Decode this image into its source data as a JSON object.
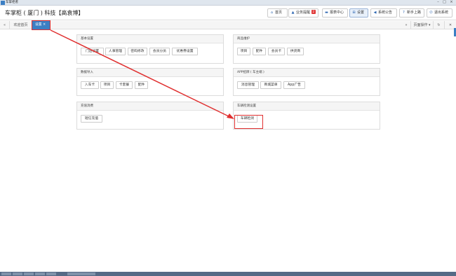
{
  "window": {
    "title": "车掌柜者",
    "minimize": "–",
    "maximize": "□",
    "close": "×"
  },
  "header": {
    "app_title": "车掌柜 ( 厦门 ) 科技【高袁博】",
    "buttons": [
      {
        "label": "首页",
        "icon": "home-icon"
      },
      {
        "label": "业务提醒",
        "icon": "bell-icon",
        "badge": "2"
      },
      {
        "label": "报表中心",
        "icon": "chart-icon"
      },
      {
        "label": "设置",
        "icon": "settings-icon"
      },
      {
        "label": "系统公告",
        "icon": "megaphone-icon"
      },
      {
        "label": "新手上路",
        "icon": "guide-icon"
      },
      {
        "label": "退出系统",
        "icon": "power-icon"
      }
    ],
    "glyphs": {
      "home": "⌂",
      "bell": "▲",
      "chart": "▬",
      "settings": "⊞",
      "megaphone": "◀",
      "guide": "?",
      "power": "⏻"
    }
  },
  "tabbar": {
    "left_arrow": "«",
    "welcome_tab": "欢迎首页",
    "active_tab": "设置",
    "active_tab_close": "×",
    "right_arrow": "»",
    "page_ops": "页面操作",
    "page_ops_caret": "▾",
    "refresh": "↻",
    "close_all": "✕"
  },
  "panels": [
    {
      "title": "基本设置",
      "items": [
        "门店设置",
        "人事管理",
        "密码修改",
        "会员分员",
        "优惠券设置"
      ]
    },
    {
      "title": "商品维护",
      "items": [
        "项目",
        "配件",
        "会员卡",
        "供货商"
      ]
    },
    {
      "title": "数据导入",
      "items": [
        "入车卡",
        "项目",
        "卡套餐",
        "配件"
      ]
    },
    {
      "title": "APP招牌 ( 车主端 )",
      "items": [
        "消息管理",
        "商城菜单",
        "App广告"
      ]
    },
    {
      "title": "充值消费",
      "items": [
        "短信充值"
      ]
    },
    {
      "title": "车辆检测设置",
      "items": [
        "车辆检测"
      ]
    }
  ],
  "colors": {
    "accent": "#3b7fc4",
    "annotation_red": "#e03030",
    "badge_red": "#e03a3a"
  }
}
